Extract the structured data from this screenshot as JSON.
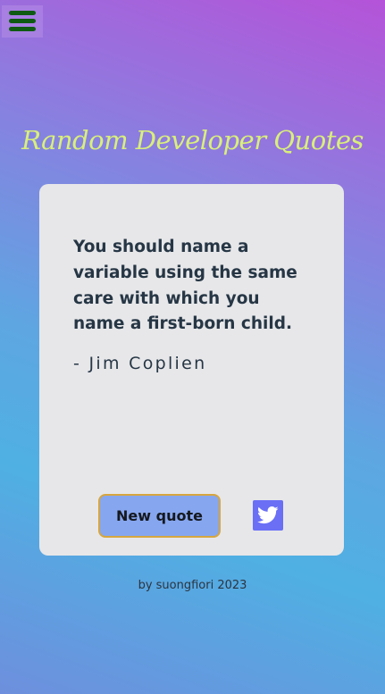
{
  "header": {
    "menu_icon": "hamburger-menu-icon",
    "title": "Random Developer Quotes",
    "title_color": "#d9ef7a"
  },
  "quote_card": {
    "quote_text": "You should name a variable using the same care with which you name a first-born child.",
    "author": "- Jim Coplien",
    "new_quote_label": "New quote",
    "new_quote_color": "#86a6ef",
    "tweet_icon": "twitter-icon",
    "tweet_color": "#6a6ff5"
  },
  "footer": {
    "credit": "by suongfiori 2023"
  }
}
